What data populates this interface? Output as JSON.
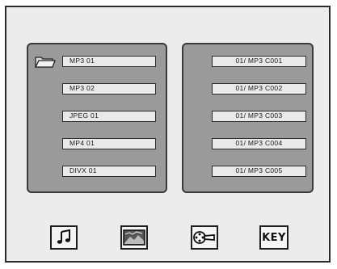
{
  "folders": [
    {
      "label": "MP3  01"
    },
    {
      "label": "MP3  02"
    },
    {
      "label": "JPEG  01"
    },
    {
      "label": "MP4  01"
    },
    {
      "label": "DIVX 01"
    }
  ],
  "files": [
    {
      "label": "01/ MP3 C001"
    },
    {
      "label": "01/ MP3 C002"
    },
    {
      "label": "01/ MP3 C003"
    },
    {
      "label": "01/ MP3 C004"
    },
    {
      "label": "01/ MP3 C005"
    }
  ],
  "bottom_bar": {
    "music_icon": "music-note-icon",
    "photo_icon": "photo-icon",
    "movie_icon": "film-reel-icon",
    "key_label": "KEY"
  },
  "colors": {
    "panel": "#9a9a9a",
    "screen": "#ececec",
    "item": "#e9e9e9"
  }
}
